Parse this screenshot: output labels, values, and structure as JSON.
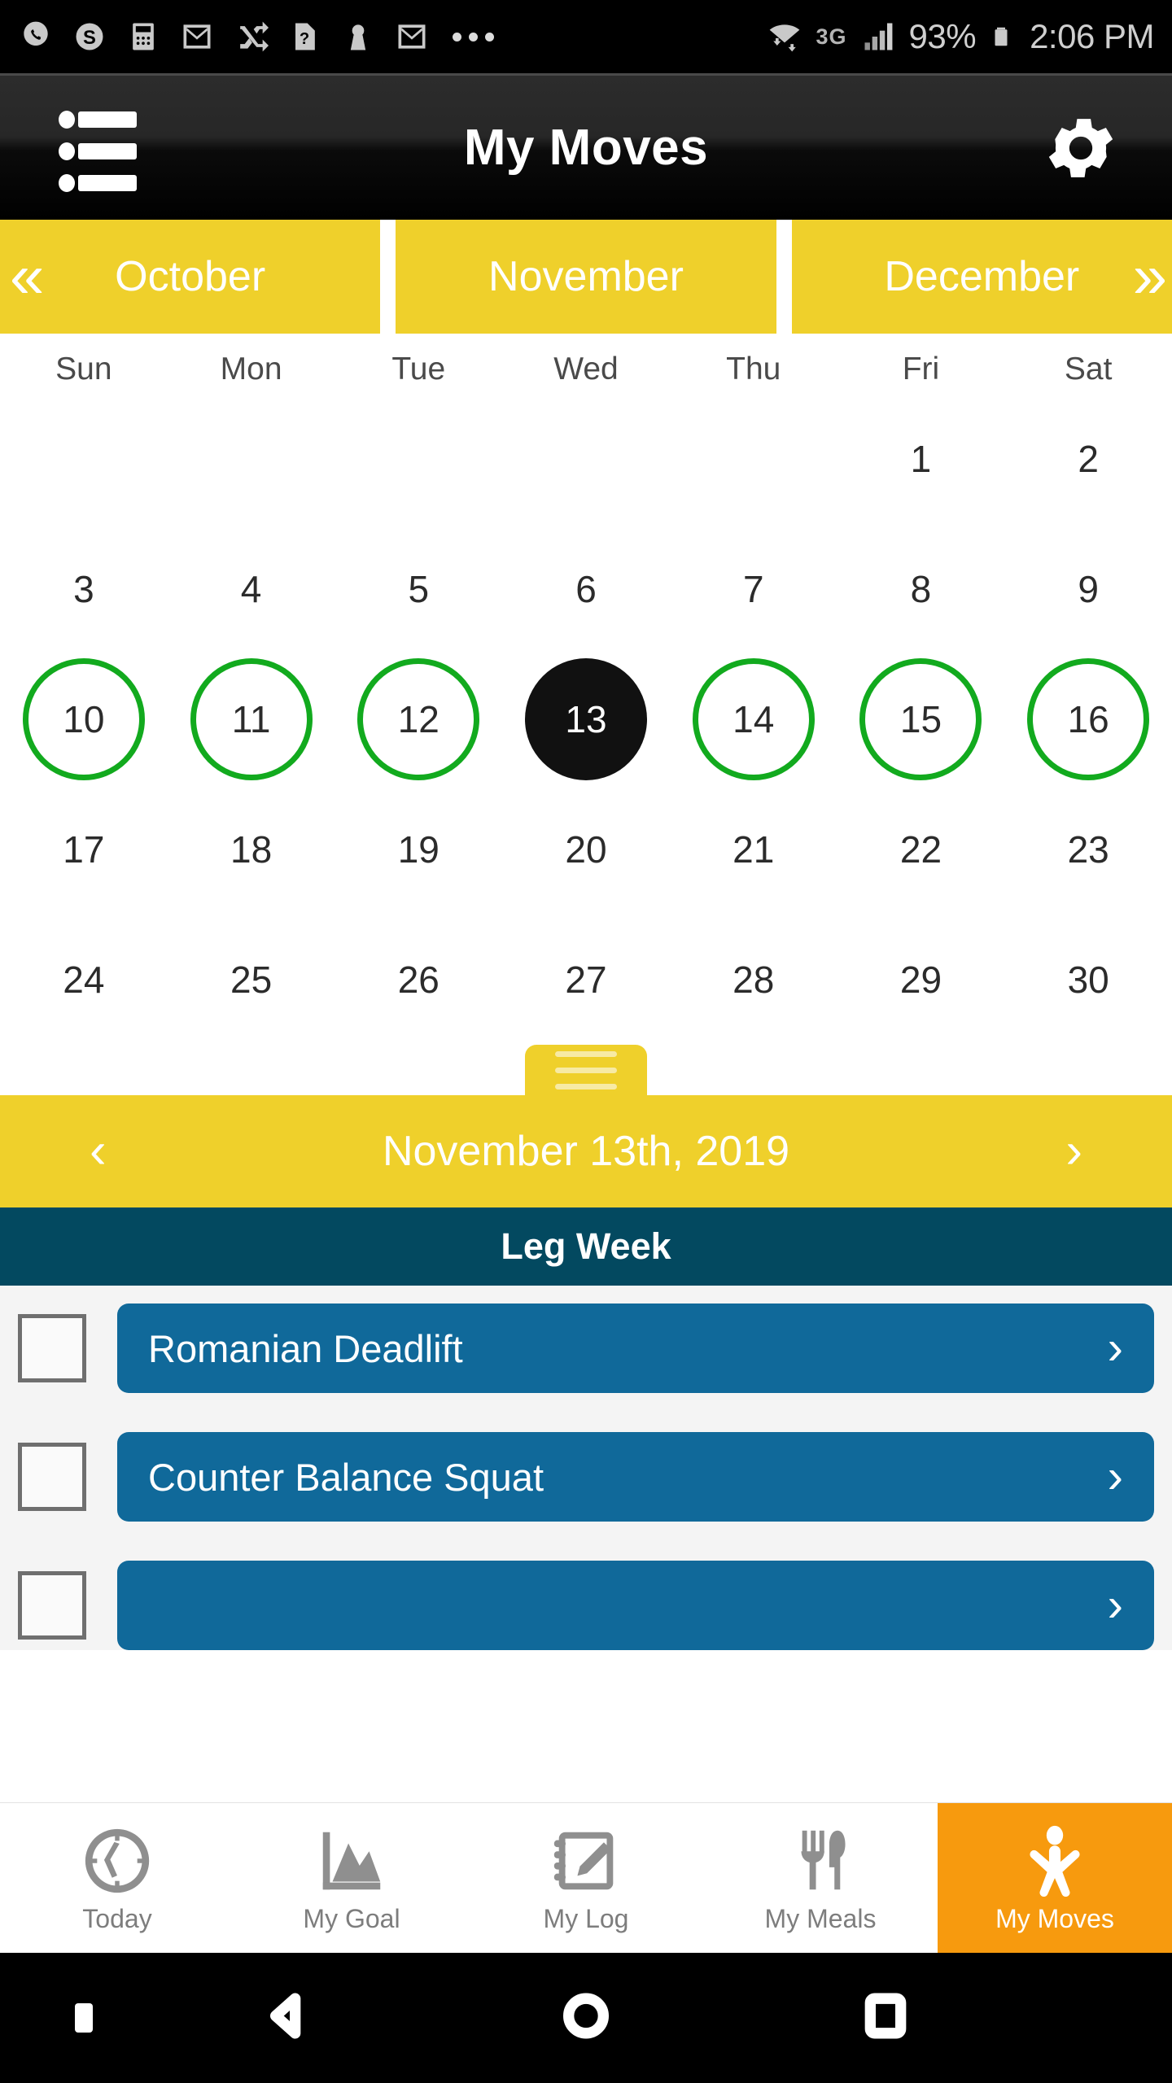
{
  "status_bar": {
    "left_icons": [
      "phone-icon",
      "skype-icon",
      "calculator-icon",
      "gmail-icon",
      "shuffle-icon",
      "unknown-file-icon",
      "contact-icon",
      "gmail-icon",
      "overflow-dots-icon"
    ],
    "wifi_icon": "wifi-transfer-icon",
    "network": "3G",
    "signal_icon": "signal-bars-icon",
    "battery_percent": "93%",
    "battery_icon": "battery-icon",
    "time": "2:06 PM"
  },
  "app_bar": {
    "menu_icon": "list-menu-icon",
    "title": "My Moves",
    "settings_icon": "gear-icon"
  },
  "months": {
    "prev_arrow": "«",
    "next_arrow": "»",
    "tabs": [
      {
        "label": "October",
        "selected": false
      },
      {
        "label": "November",
        "selected": true
      },
      {
        "label": "December",
        "selected": false
      }
    ]
  },
  "calendar": {
    "weekdays": [
      "Sun",
      "Mon",
      "Tue",
      "Wed",
      "Thu",
      "Fri",
      "Sat"
    ],
    "selected_day": 13,
    "ringed_days": [
      10,
      11,
      12,
      14,
      15,
      16
    ],
    "ring_color": "#12AA1E",
    "today_bg": "#111111",
    "rows": [
      [
        "",
        "",
        "",
        "",
        "",
        "1",
        "2"
      ],
      [
        "3",
        "4",
        "5",
        "6",
        "7",
        "8",
        "9"
      ],
      [
        "10",
        "11",
        "12",
        "13",
        "14",
        "15",
        "16"
      ],
      [
        "17",
        "18",
        "19",
        "20",
        "21",
        "22",
        "23"
      ],
      [
        "24",
        "25",
        "26",
        "27",
        "28",
        "29",
        "30"
      ]
    ]
  },
  "drag_handle": {
    "icon": "drag-handle-icon"
  },
  "date_bar": {
    "prev_arrow": "‹",
    "date": "November 13th, 2019",
    "next_arrow": "›"
  },
  "workout": {
    "title": "Leg Week",
    "exercises": [
      {
        "name": "Romanian Deadlift",
        "checked": false,
        "chevron": "›"
      },
      {
        "name": "Counter Balance Squat",
        "checked": false,
        "chevron": "›"
      },
      {
        "name": "",
        "checked": false,
        "chevron": "›"
      }
    ]
  },
  "tab_bar": {
    "tabs": [
      {
        "label": "Today",
        "icon": "clock-icon",
        "active": false
      },
      {
        "label": "My Goal",
        "icon": "area-chart-icon",
        "active": false
      },
      {
        "label": "My Log",
        "icon": "notebook-pencil-icon",
        "active": false
      },
      {
        "label": "My Meals",
        "icon": "fork-knife-icon",
        "active": false
      },
      {
        "label": "My Moves",
        "icon": "person-jumping-icon",
        "active": true
      }
    ],
    "active_color": "#F79A0E"
  },
  "nav_bar": {
    "buttons": [
      "dot-indicator-icon",
      "back-triangle-icon",
      "home-circle-icon",
      "recents-square-icon"
    ]
  },
  "colors": {
    "yellow": "#EFD02B",
    "teal": "#034960",
    "blue": "#10699A",
    "green": "#12AA1E",
    "orange": "#F79A0E"
  }
}
